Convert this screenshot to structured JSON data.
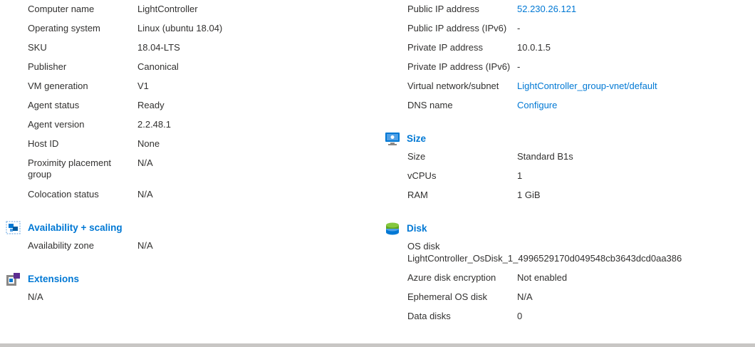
{
  "left": {
    "properties": [
      {
        "label": "Computer name",
        "value": "LightController"
      },
      {
        "label": "Operating system",
        "value": "Linux (ubuntu 18.04)"
      },
      {
        "label": "SKU",
        "value": "18.04-LTS"
      },
      {
        "label": "Publisher",
        "value": "Canonical"
      },
      {
        "label": "VM generation",
        "value": "V1"
      },
      {
        "label": "Agent status",
        "value": "Ready"
      },
      {
        "label": "Agent version",
        "value": "2.2.48.1"
      },
      {
        "label": "Host ID",
        "value": "None"
      },
      {
        "label": "Proximity placement group",
        "value": "N/A"
      },
      {
        "label": "Colocation status",
        "value": "N/A"
      }
    ],
    "availability": {
      "title": "Availability + scaling",
      "icon": "availability-scaling-icon",
      "rows": [
        {
          "label": "Availability zone",
          "value": "N/A"
        }
      ]
    },
    "extensions": {
      "title": "Extensions",
      "icon": "extensions-icon",
      "value": "N/A"
    }
  },
  "right": {
    "networking": [
      {
        "label": "Public IP address",
        "value": "52.230.26.121"
      },
      {
        "label": "Public IP address (IPv6)",
        "value": "-"
      },
      {
        "label": "Private IP address",
        "value": "10.0.1.5"
      },
      {
        "label": "Private IP address (IPv6)",
        "value": "-"
      },
      {
        "label": "Virtual network/subnet",
        "value": "LightController_group-vnet/default"
      },
      {
        "label": "DNS name",
        "value": "Configure"
      }
    ],
    "size": {
      "title": "Size",
      "icon": "vm-size-icon",
      "rows": [
        {
          "label": "Size",
          "value": "Standard B1s"
        },
        {
          "label": "vCPUs",
          "value": "1"
        },
        {
          "label": "RAM",
          "value": "1 GiB"
        }
      ]
    },
    "disk": {
      "title": "Disk",
      "icon": "disk-icon",
      "os_disk_label": "OS disk",
      "os_disk_value": "LightController_OsDisk_1_4996529170d049548cb3643dcd0aa386",
      "rows": [
        {
          "label": "Azure disk encryption",
          "value": "Not enabled"
        },
        {
          "label": "Ephemeral OS disk",
          "value": "N/A"
        },
        {
          "label": "Data disks",
          "value": "0"
        }
      ]
    }
  },
  "colors": {
    "link": "#0078d4",
    "text": "#323130",
    "scrollbar": "#c8c6c4"
  }
}
